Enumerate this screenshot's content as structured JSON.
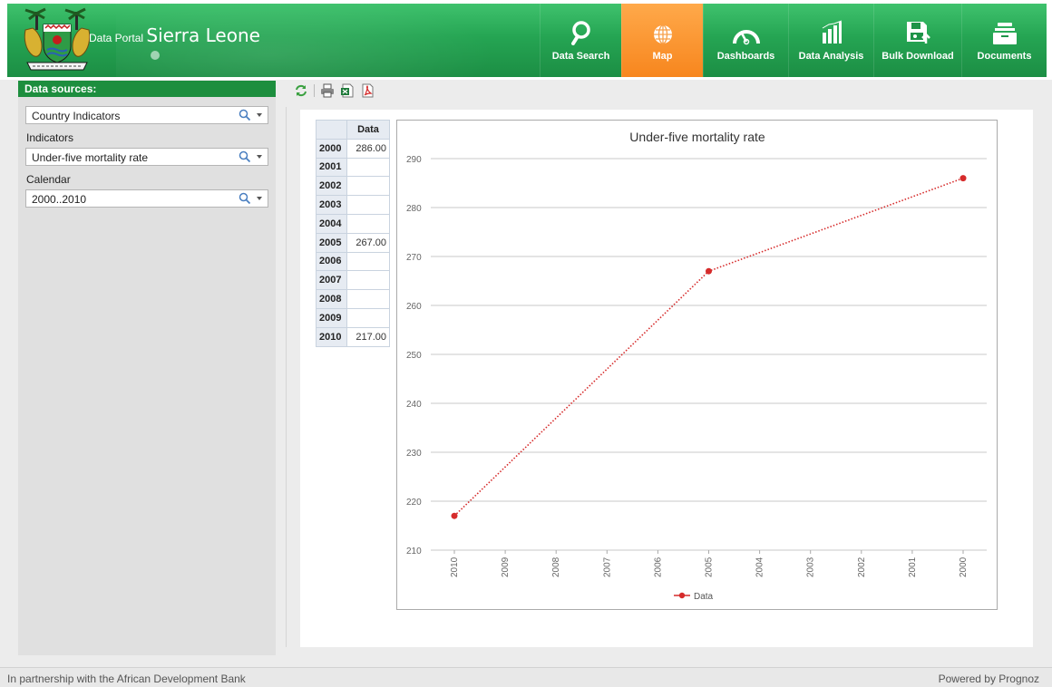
{
  "header": {
    "brand_small": "Data Portal",
    "brand_big": "Sierra Leone",
    "nav": [
      {
        "label": "Data Search",
        "icon": "search-icon",
        "active": false
      },
      {
        "label": "Map",
        "icon": "globe-icon",
        "active": true
      },
      {
        "label": "Dashboards",
        "icon": "gauge-icon",
        "active": false
      },
      {
        "label": "Data Analysis",
        "icon": "bar-chart-icon",
        "active": false
      },
      {
        "label": "Bulk Download",
        "icon": "floppy-download-icon",
        "active": false
      },
      {
        "label": "Documents",
        "icon": "documents-icon",
        "active": false
      }
    ],
    "colors": {
      "green": "#25a553",
      "active_orange": "#f7861e"
    }
  },
  "sidebar": {
    "title": "Data sources:",
    "source_value": "Country Indicators",
    "indicators_label": "Indicators",
    "indicator_value": "Under-five mortality rate",
    "calendar_label": "Calendar",
    "calendar_value": "2000..2010"
  },
  "toolbar": {
    "buttons": [
      "refresh-icon",
      "print-icon",
      "excel-export-icon",
      "pdf-export-icon"
    ]
  },
  "table": {
    "column_header": "Data",
    "rows": [
      {
        "year": "2000",
        "value": "286.00"
      },
      {
        "year": "2001",
        "value": ""
      },
      {
        "year": "2002",
        "value": ""
      },
      {
        "year": "2003",
        "value": ""
      },
      {
        "year": "2004",
        "value": ""
      },
      {
        "year": "2005",
        "value": "267.00"
      },
      {
        "year": "2006",
        "value": ""
      },
      {
        "year": "2007",
        "value": ""
      },
      {
        "year": "2008",
        "value": ""
      },
      {
        "year": "2009",
        "value": ""
      },
      {
        "year": "2010",
        "value": "217.00"
      }
    ]
  },
  "chart_data": {
    "type": "line",
    "title": "Under-five mortality rate",
    "categories": [
      "2010",
      "2009",
      "2008",
      "2007",
      "2006",
      "2005",
      "2004",
      "2003",
      "2002",
      "2001",
      "2000"
    ],
    "series": [
      {
        "name": "Data",
        "values": [
          217,
          null,
          null,
          null,
          null,
          267,
          null,
          null,
          null,
          null,
          286
        ],
        "color": "#d62b2b"
      }
    ],
    "y_ticks": [
      210,
      220,
      230,
      240,
      250,
      260,
      270,
      280,
      290
    ],
    "ylim": [
      210,
      290
    ],
    "grid": true,
    "legend_position": "bottom",
    "line_style": "dotted"
  },
  "footer": {
    "left": "In partnership with the African Development Bank",
    "right": "Powered by Prognoz"
  }
}
